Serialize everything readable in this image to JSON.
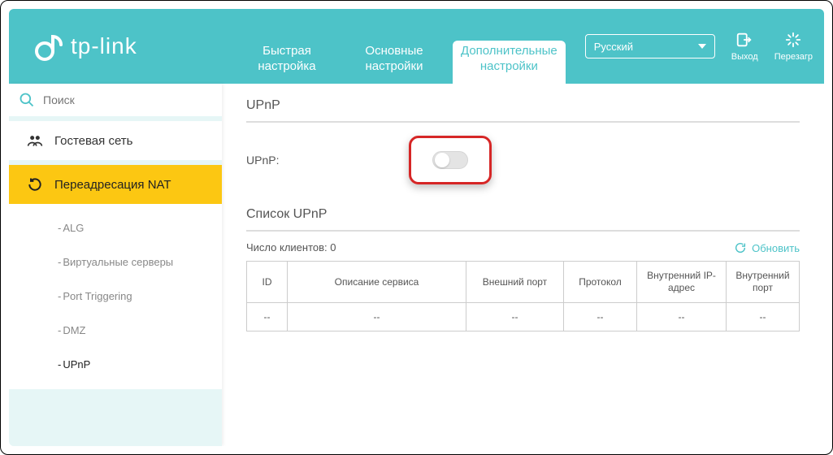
{
  "brand": "tp-link",
  "tabs": {
    "quick": {
      "line1": "Быстрая",
      "line2": "настройка"
    },
    "basic": {
      "line1": "Основные",
      "line2": "настройки"
    },
    "advanced": {
      "line1": "Дополнительные",
      "line2": "настройки"
    }
  },
  "lang": {
    "selected": "Русский"
  },
  "icons": {
    "logout": "Выход",
    "reboot": "Перезагр"
  },
  "search": {
    "placeholder": "Поиск"
  },
  "sidebar": {
    "guest": "Гостевая сеть",
    "nat": "Переадресация NAT",
    "sub": {
      "alg": "ALG",
      "vservers": "Виртуальные серверы",
      "ptrig": "Port Triggering",
      "dmz": "DMZ",
      "upnp": "UPnP"
    }
  },
  "main": {
    "section1_title": "UPnP",
    "upnp_label": "UPnP:",
    "section2_title": "Список UPnP",
    "clients_label": "Число клиентов: 0",
    "refresh": "Обновить",
    "table": {
      "headers": {
        "id": "ID",
        "desc": "Описание сервиса",
        "ext_port": "Внешний порт",
        "proto": "Протокол",
        "int_ip": "Внутренний IP-адрес",
        "int_port": "Внутренний порт"
      },
      "empty": "--"
    }
  }
}
